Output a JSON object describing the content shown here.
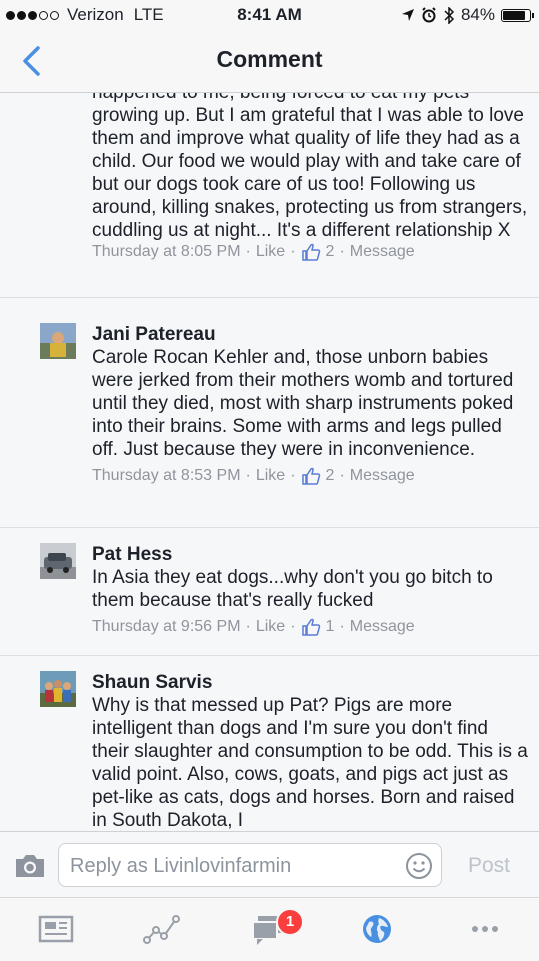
{
  "status_bar": {
    "carrier": "Verizon",
    "network": "LTE",
    "time": "8:41 AM",
    "battery": "84%",
    "battery_level": 0.84
  },
  "nav": {
    "title": "Comment",
    "back_icon": "chevron-left-icon"
  },
  "comments": [
    {
      "text": "happened to me, being forced to eat my pets growing up. But I am grateful that I was able to love them and improve what quality of life they had as a child. Our food we would play with and take care of but our dogs took care of us too! Following us around, killing snakes, protecting us from strangers, cuddling us at night... It's a different relationship X",
      "time": "Thursday at 8:05 PM",
      "like": "Like",
      "like_count": "2",
      "message": "Message"
    },
    {
      "author": "Jani Patereau",
      "text": "Carole Rocan Kehler and, those unborn babies were jerked from their mothers womb and tortured until they died, most with sharp instruments poked into their brains. Some with arms and legs pulled off. Just because they were in inconvenience.",
      "time": "Thursday at 8:53 PM",
      "like": "Like",
      "like_count": "2",
      "message": "Message"
    },
    {
      "author": "Pat Hess",
      "text": "In Asia they eat dogs...why don't you go bitch to them because that's really fucked",
      "time": "Thursday at 9:56 PM",
      "like": "Like",
      "like_count": "1",
      "message": "Message"
    },
    {
      "author": "Shaun Sarvis",
      "text": "Why is that messed up Pat? Pigs are more intelligent than dogs and I'm sure you don't find their slaughter and consumption to be odd. This is a valid point. Also, cows, goats, and pigs act just as pet-like as cats, dogs and horses. Born and raised in South Dakota, I"
    }
  ],
  "reply": {
    "placeholder": "Reply as Livinlovinfarmin",
    "post_label": "Post"
  },
  "tab_bar": {
    "notifications_badge": "1"
  },
  "colors": {
    "accent": "#4a90e2",
    "meta_gray": "#90949c",
    "badge_red": "#fa3e3e"
  }
}
